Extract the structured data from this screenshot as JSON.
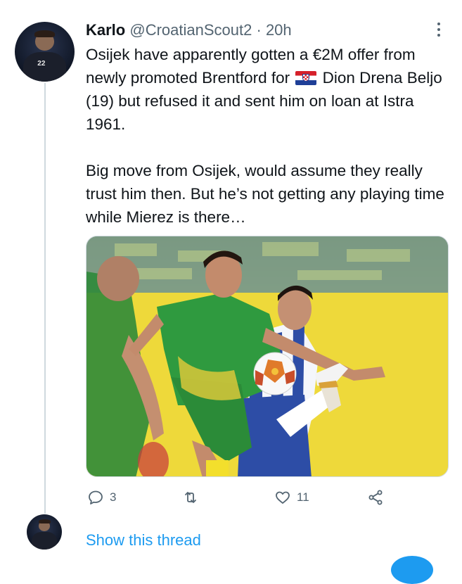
{
  "tweet": {
    "author_name": "Karlo",
    "author_handle": "@CroatianScout2",
    "separator": "·",
    "time": "20h",
    "paragraph1_before_flag": "Osijek have apparently gotten a €2M offer from newly promoted Brentford for ",
    "flag_icon": "croatia-flag-icon",
    "paragraph1_after_flag": " Dion Drena Beljo (19) but refused it and sent him on loan at Istra 1961.",
    "paragraph2": "Big move from Osijek, would assume they really trust him then. But he’s not getting any playing time while Mierez is there…",
    "media_description_icon": "football-match-photo"
  },
  "actions": {
    "reply_icon": "reply-icon",
    "reply_count": "3",
    "retweet_icon": "retweet-icon",
    "retweet_count": "",
    "like_icon": "heart-icon",
    "like_count": "11",
    "share_icon": "share-icon"
  },
  "thread": {
    "show_label": "Show this thread"
  },
  "colors": {
    "link_blue": "#1d9bf0",
    "secondary_text": "#536471",
    "thread_line": "#cfd9de"
  }
}
